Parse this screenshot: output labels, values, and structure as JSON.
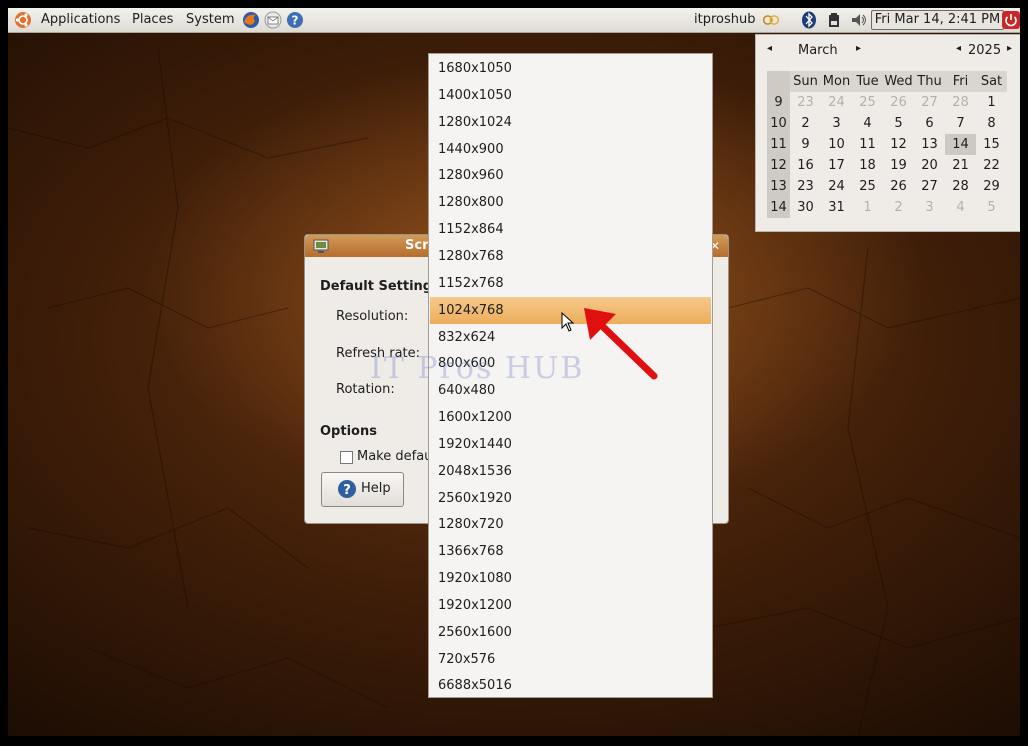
{
  "panel": {
    "menus": [
      "Applications",
      "Places",
      "System"
    ],
    "username": "itproshub",
    "clock": "Fri Mar 14,  2:41 PM"
  },
  "calendar": {
    "month": "March",
    "year": "2025",
    "day_names": [
      "Sun",
      "Mon",
      "Tue",
      "Wed",
      "Thu",
      "Fri",
      "Sat"
    ],
    "weeks": [
      {
        "num": "9",
        "days": [
          "23",
          "24",
          "25",
          "26",
          "27",
          "28",
          "1"
        ]
      },
      {
        "num": "10",
        "days": [
          "2",
          "3",
          "4",
          "5",
          "6",
          "7",
          "8"
        ]
      },
      {
        "num": "11",
        "days": [
          "9",
          "10",
          "11",
          "12",
          "13",
          "14",
          "15"
        ]
      },
      {
        "num": "12",
        "days": [
          "16",
          "17",
          "18",
          "19",
          "20",
          "21",
          "22"
        ]
      },
      {
        "num": "13",
        "days": [
          "23",
          "24",
          "25",
          "26",
          "27",
          "28",
          "29"
        ]
      },
      {
        "num": "14",
        "days": [
          "30",
          "31",
          "1",
          "2",
          "3",
          "4",
          "5"
        ]
      }
    ],
    "selected_day": "14"
  },
  "dialog": {
    "title": "Scr",
    "section_default": "Default Setting",
    "resolution_label": "Resolution:",
    "refresh_label": "Refresh rate:",
    "rotation_label": "Rotation:",
    "section_options": "Options",
    "make_default_label": "Make defau",
    "help_button": "Help"
  },
  "resolutions": [
    "1680x1050",
    "1400x1050",
    "1280x1024",
    "1440x900",
    "1280x960",
    "1280x800",
    "1152x864",
    "1280x768",
    "1152x768",
    "1024x768",
    "832x624",
    "800x600",
    "640x480",
    "1600x1200",
    "1920x1440",
    "2048x1536",
    "2560x1920",
    "1280x720",
    "1366x768",
    "1920x1080",
    "1920x1200",
    "2560x1600",
    "720x576",
    "6688x5016"
  ],
  "selected_resolution": "1024x768",
  "watermark": "IT Pros HUB",
  "colors": {
    "highlight": "#ecad5c",
    "titlebar": "#b46d2d",
    "arrow": "#e01010"
  }
}
